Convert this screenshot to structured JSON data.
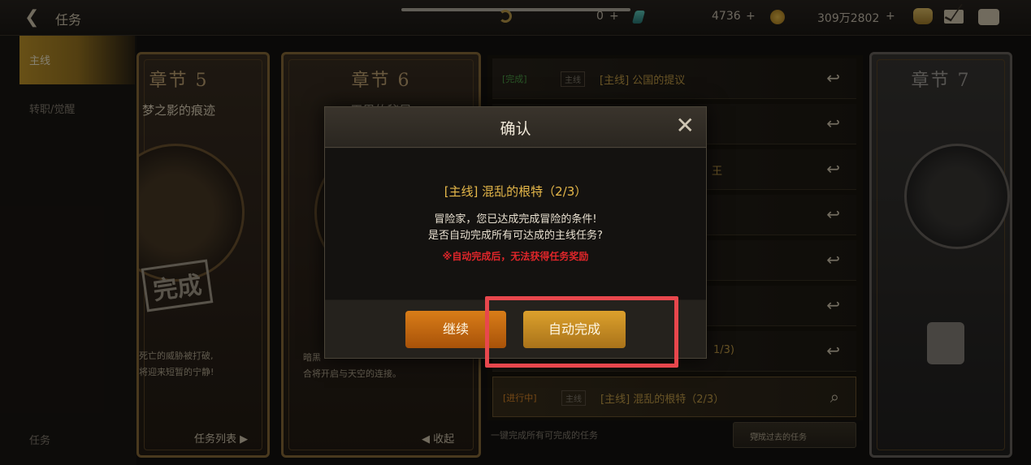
{
  "topbar": {
    "back_label": "任务",
    "moon_value": "0",
    "gem_value": "4736",
    "coin_value": "309万2802",
    "plus": "+"
  },
  "sidebar": {
    "items": [
      {
        "label": "主线",
        "active": true
      },
      {
        "label": "转职/觉醒",
        "active": false
      }
    ],
    "bottom_label": "任务"
  },
  "chapters": [
    {
      "title": "章节 5",
      "subtitle": "梦之影的痕迹",
      "stamp": "完成",
      "desc_lines": [
        "死亡的威胁被打破,",
        "将迎来短暂的宁静!"
      ],
      "link": "任务列表 ▶"
    },
    {
      "title": "章节 6",
      "subtitle": "天界的秘早",
      "desc_lines": [
        "暗黑",
        "合将开启与天空的连接。"
      ],
      "link": "◀ 收起"
    },
    {
      "title": "章节 7"
    }
  ],
  "quests": [
    {
      "tag": "[完成]",
      "type": "主线",
      "name": "[主线] 公国的提议"
    },
    {
      "tag": "",
      "type": "",
      "name": ""
    },
    {
      "tag": "",
      "type": "",
      "name": "王"
    },
    {
      "tag": "",
      "type": "",
      "name": ""
    },
    {
      "tag": "",
      "type": "",
      "name": ""
    },
    {
      "tag": "",
      "type": "",
      "name": ""
    },
    {
      "tag": "",
      "type": "",
      "name": "1/3)"
    },
    {
      "tag": "[进行中]",
      "type": "主线",
      "name": "[主线] 混乱的根特（2/3）"
    }
  ],
  "list_footer": {
    "hint": "一键完成所有可完成的任务",
    "button": "完成过去的任务"
  },
  "dialog": {
    "title": "确认",
    "quest": "[主线] 混乱的根特（2/3）",
    "message_line1": "冒险家，您已达成完成冒险的条件!",
    "message_line2": "是否自动完成所有可达成的主线任务?",
    "warning": "※自动完成后，无法获得任务奖励",
    "btn_continue": "继续",
    "btn_auto": "自动完成"
  },
  "colors": {
    "accent_gold": "#dca02c",
    "accent_orange": "#d97d18",
    "warning_red": "#e0262a",
    "highlight_red": "#e8474d"
  }
}
